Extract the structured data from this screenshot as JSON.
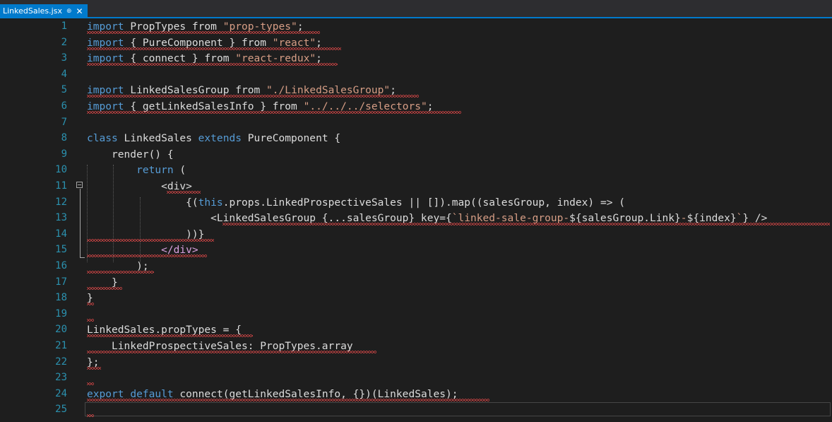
{
  "tab": {
    "title": "LinkedSales.jsx",
    "pin_icon": "pin-icon",
    "close_icon": "close-icon",
    "pin_glyph": "⊕",
    "close_glyph": "✕"
  },
  "colors": {
    "keyword": "#569cd6",
    "string": "#d69d85",
    "tag": "#d8a0df",
    "plain": "#dcdcdc",
    "line_number": "#2b91af",
    "tab_active": "#007acc",
    "error_squiggle": "#f14c4c",
    "background": "#1e1e1e"
  },
  "lines": [
    {
      "n": "1",
      "tokens": [
        {
          "t": "import",
          "c": "kw"
        },
        {
          "t": " PropTypes ",
          "c": "plain"
        },
        {
          "t": "from",
          "c": "plain"
        },
        {
          "t": " ",
          "c": "plain"
        },
        {
          "t": "\"prop-types\"",
          "c": "str"
        },
        {
          "t": ";",
          "c": "plain"
        }
      ]
    },
    {
      "n": "2",
      "tokens": [
        {
          "t": "import",
          "c": "kw"
        },
        {
          "t": " { PureComponent } ",
          "c": "plain"
        },
        {
          "t": "from",
          "c": "plain"
        },
        {
          "t": " ",
          "c": "plain"
        },
        {
          "t": "\"react\"",
          "c": "str"
        },
        {
          "t": ";",
          "c": "plain"
        }
      ]
    },
    {
      "n": "3",
      "tokens": [
        {
          "t": "import",
          "c": "kw"
        },
        {
          "t": " { connect } ",
          "c": "plain"
        },
        {
          "t": "from",
          "c": "plain"
        },
        {
          "t": " ",
          "c": "plain"
        },
        {
          "t": "\"react-redux\"",
          "c": "str"
        },
        {
          "t": ";",
          "c": "plain"
        }
      ]
    },
    {
      "n": "4",
      "tokens": []
    },
    {
      "n": "5",
      "tokens": [
        {
          "t": "import",
          "c": "kw"
        },
        {
          "t": " LinkedSalesGroup ",
          "c": "plain"
        },
        {
          "t": "from",
          "c": "plain"
        },
        {
          "t": " ",
          "c": "plain"
        },
        {
          "t": "\"./LinkedSalesGroup\"",
          "c": "str"
        },
        {
          "t": ";",
          "c": "plain"
        }
      ]
    },
    {
      "n": "6",
      "tokens": [
        {
          "t": "import",
          "c": "kw"
        },
        {
          "t": " { getLinkedSalesInfo } ",
          "c": "plain"
        },
        {
          "t": "from",
          "c": "plain"
        },
        {
          "t": " ",
          "c": "plain"
        },
        {
          "t": "\"../../../selectors\"",
          "c": "str"
        },
        {
          "t": ";",
          "c": "plain"
        }
      ]
    },
    {
      "n": "7",
      "tokens": []
    },
    {
      "n": "8",
      "tokens": [
        {
          "t": "class",
          "c": "kw"
        },
        {
          "t": " LinkedSales ",
          "c": "plain"
        },
        {
          "t": "extends",
          "c": "kw"
        },
        {
          "t": " PureComponent {",
          "c": "plain"
        }
      ]
    },
    {
      "n": "9",
      "tokens": [
        {
          "t": "    render() {",
          "c": "plain"
        }
      ]
    },
    {
      "n": "10",
      "tokens": [
        {
          "t": "        ",
          "c": "plain"
        },
        {
          "t": "return",
          "c": "kw"
        },
        {
          "t": " (",
          "c": "plain"
        }
      ]
    },
    {
      "n": "11",
      "tokens": [
        {
          "t": "            ",
          "c": "plain"
        },
        {
          "t": "<div>",
          "c": "plain"
        }
      ]
    },
    {
      "n": "12",
      "tokens": [
        {
          "t": "                {(",
          "c": "plain"
        },
        {
          "t": "this",
          "c": "kw"
        },
        {
          "t": ".props.LinkedProspectiveSales || []).map((salesGroup, index) => (",
          "c": "plain"
        }
      ]
    },
    {
      "n": "13",
      "tokens": [
        {
          "t": "                    <LinkedSalesGroup {...salesGroup} key={",
          "c": "plain"
        },
        {
          "t": "`linked-sale-group-",
          "c": "str"
        },
        {
          "t": "${salesGroup.Link}",
          "c": "plain"
        },
        {
          "t": "-",
          "c": "str"
        },
        {
          "t": "${index}",
          "c": "plain"
        },
        {
          "t": "`",
          "c": "str"
        },
        {
          "t": "} />",
          "c": "plain"
        }
      ]
    },
    {
      "n": "14",
      "tokens": [
        {
          "t": "                ))}",
          "c": "plain"
        }
      ]
    },
    {
      "n": "15",
      "tokens": [
        {
          "t": "            ",
          "c": "plain"
        },
        {
          "t": "</div>",
          "c": "tag"
        }
      ]
    },
    {
      "n": "16",
      "tokens": [
        {
          "t": "        );",
          "c": "plain"
        }
      ]
    },
    {
      "n": "17",
      "tokens": [
        {
          "t": "    }",
          "c": "plain"
        }
      ]
    },
    {
      "n": "18",
      "tokens": [
        {
          "t": "}",
          "c": "plain"
        }
      ]
    },
    {
      "n": "19",
      "tokens": []
    },
    {
      "n": "20",
      "tokens": [
        {
          "t": "LinkedSales.propTypes = {",
          "c": "plain"
        }
      ]
    },
    {
      "n": "21",
      "tokens": [
        {
          "t": "    LinkedProspectiveSales: PropTypes.array",
          "c": "plain"
        }
      ]
    },
    {
      "n": "22",
      "tokens": [
        {
          "t": "};",
          "c": "plain"
        }
      ]
    },
    {
      "n": "23",
      "tokens": []
    },
    {
      "n": "24",
      "tokens": [
        {
          "t": "export",
          "c": "kw"
        },
        {
          "t": " ",
          "c": "plain"
        },
        {
          "t": "default",
          "c": "kw"
        },
        {
          "t": " connect(getLinkedSalesInfo, {})(LinkedSales);",
          "c": "plain"
        }
      ]
    },
    {
      "n": "25",
      "tokens": []
    }
  ]
}
